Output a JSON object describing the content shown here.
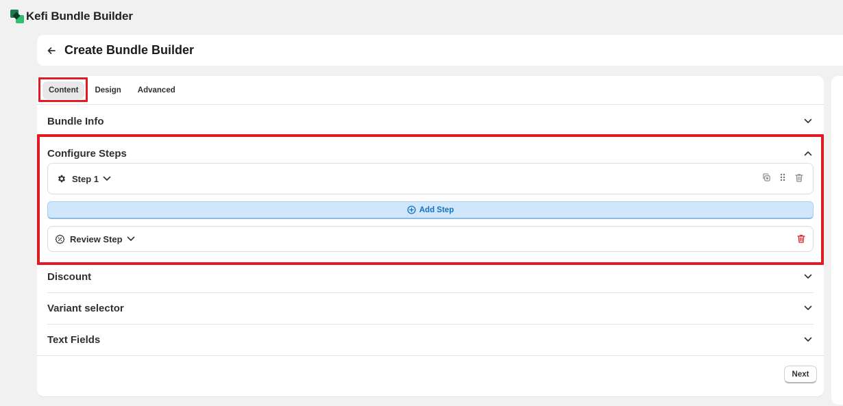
{
  "app": {
    "title": "Kefi Bundle Builder",
    "logo_icon": "kefi-logo-icon"
  },
  "page": {
    "title": "Create Bundle Builder",
    "back_icon": "arrow-left-icon"
  },
  "tabs": [
    {
      "label": "Content",
      "active": true
    },
    {
      "label": "Design",
      "active": false
    },
    {
      "label": "Advanced",
      "active": false
    }
  ],
  "sections": {
    "bundle_info": {
      "title": "Bundle Info",
      "expanded": false
    },
    "configure_steps": {
      "title": "Configure Steps",
      "expanded": true,
      "steps": [
        {
          "label": "Step 1",
          "icon": "gear-icon",
          "actions": [
            "duplicate-icon",
            "drag-handle-icon",
            "trash-icon"
          ]
        }
      ],
      "add_step_label": "Add Step",
      "review_step": {
        "label": "Review Step",
        "icon": "badge-percent-icon",
        "action": "trash-icon"
      }
    },
    "discount": {
      "title": "Discount",
      "expanded": false
    },
    "variant_selector": {
      "title": "Variant selector",
      "expanded": false
    },
    "text_fields": {
      "title": "Text Fields",
      "expanded": false
    }
  },
  "footer": {
    "next_label": "Next"
  },
  "colors": {
    "highlight": "#e01b24",
    "accent_blue": "#1570c4",
    "add_step_bg": "#cfe6fb",
    "danger": "#e01b24"
  }
}
